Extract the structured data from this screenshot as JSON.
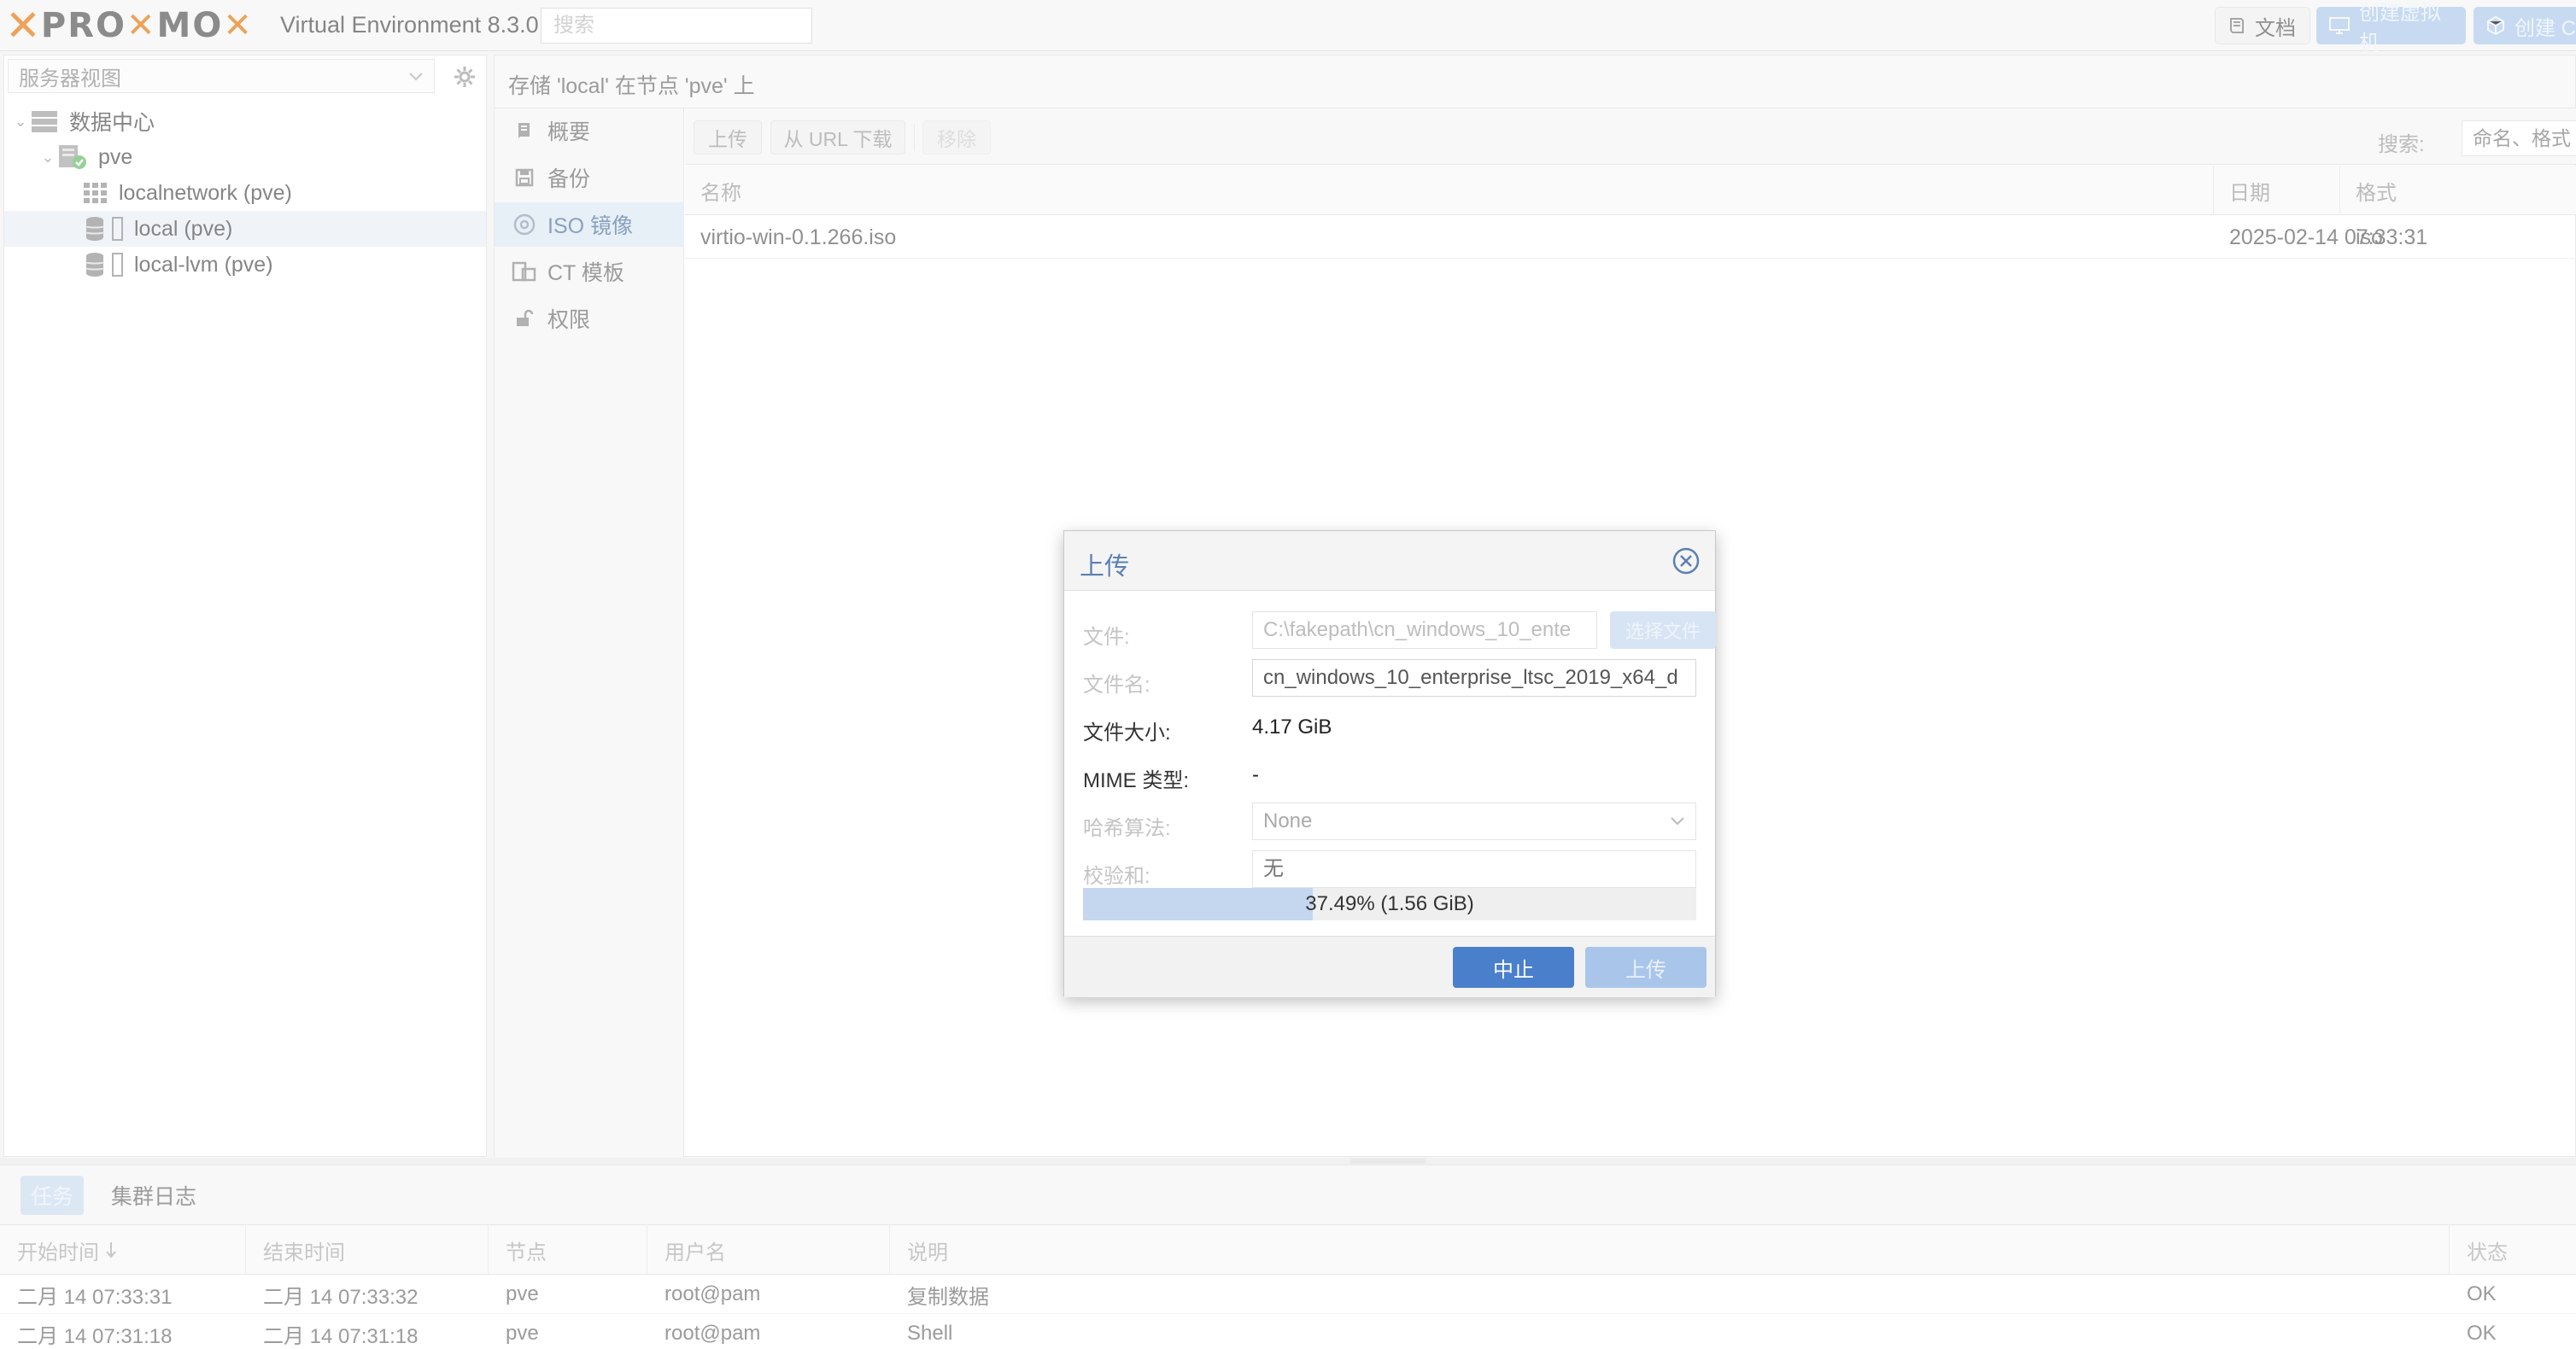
{
  "header": {
    "product_version": "Virtual Environment 8.3.0",
    "search_placeholder": "搜索",
    "docs_label": "文档",
    "create_vm_label": "创建虚拟机",
    "create_ct_label": "创建 C"
  },
  "sidebar": {
    "view_label": "服务器视图",
    "tree": {
      "datacenter": "数据中心",
      "node": "pve",
      "localnetwork": "localnetwork (pve)",
      "local": "local (pve)",
      "local_lvm": "local-lvm (pve)"
    }
  },
  "content": {
    "title": "存储 'local' 在节点 'pve' 上",
    "menu": [
      "概要",
      "备份",
      "ISO 镜像",
      "CT 模板",
      "权限"
    ],
    "toolbar": {
      "upload": "上传",
      "download_url": "从 URL 下载",
      "remove": "移除",
      "search_label": "搜索:",
      "search_placeholder": "命名、格式"
    },
    "columns": [
      "名称",
      "日期",
      "格式"
    ],
    "rows": [
      {
        "name": "virtio-win-0.1.266.iso",
        "date": "2025-02-14 07:33:31",
        "format": "iso"
      }
    ]
  },
  "upload_dialog": {
    "title": "上传",
    "file_label": "文件:",
    "file_value": "C:\\fakepath\\cn_windows_10_ente",
    "choose_file": "选择文件",
    "filename_label": "文件名:",
    "filename_value": "cn_windows_10_enterprise_ltsc_2019_x64_d",
    "size_label": "文件大小:",
    "size_value": "4.17 GiB",
    "mime_label": "MIME 类型:",
    "mime_value": "-",
    "hash_label": "哈希算法:",
    "hash_value": "None",
    "checksum_label": "校验和:",
    "checksum_placeholder": "无",
    "progress": 0.3749,
    "progress_text": "37.49% (1.56 GiB)",
    "abort": "中止",
    "upload": "上传"
  },
  "tasks": {
    "tabs": [
      "任务",
      "集群日志"
    ],
    "columns": [
      "开始时间",
      "结束时间",
      "节点",
      "用户名",
      "说明",
      "状态"
    ],
    "rows": [
      {
        "start": "二月 14 07:33:31",
        "end": "二月 14 07:33:32",
        "node": "pve",
        "user": "root@pam",
        "desc": "复制数据",
        "status": "OK"
      },
      {
        "start": "二月 14 07:31:18",
        "end": "二月 14 07:31:18",
        "node": "pve",
        "user": "root@pam",
        "desc": "Shell",
        "status": "OK"
      }
    ]
  },
  "colors": {
    "accent": "#e57000",
    "primary_button": "#4a7fcc",
    "selection": "#dbe6f3"
  }
}
